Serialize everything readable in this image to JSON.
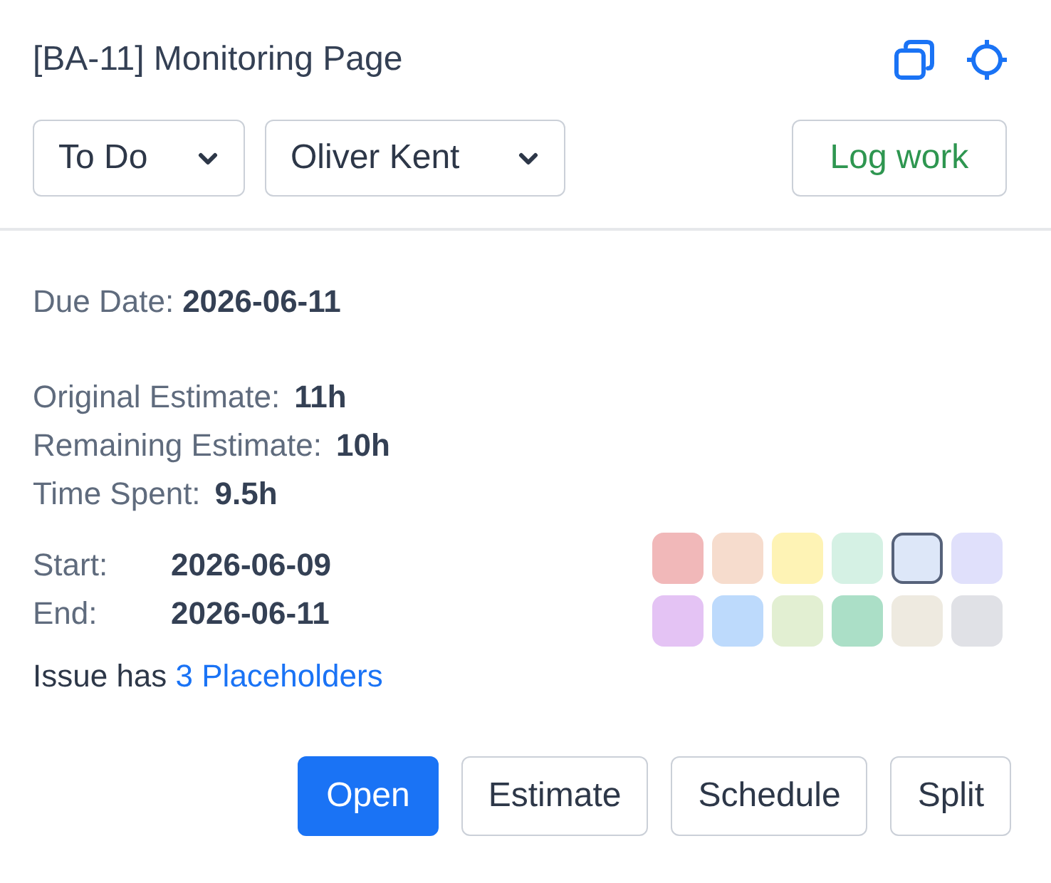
{
  "header": {
    "title": "[BA-11] Monitoring Page"
  },
  "dropdowns": [
    {
      "value": "To Do"
    },
    {
      "value": "Oliver Kent"
    }
  ],
  "log_work_button": {
    "label": "Log work"
  },
  "due_date": {
    "label": "Due Date:",
    "value": "2026-06-11"
  },
  "estimates": [
    {
      "label": "Original Estimate:",
      "value": "11h"
    },
    {
      "label": "Remaining Estimate:",
      "value": "10h"
    },
    {
      "label": "Time Spent:",
      "value": "9.5h"
    }
  ],
  "schedule": [
    {
      "label": "Start:",
      "value": "2026-06-09"
    },
    {
      "label": "End:",
      "value": "2026-06-11"
    }
  ],
  "placeholder_note": {
    "text": "Issue has",
    "link": "3 Placeholders"
  },
  "swatches": [
    {
      "color": "#f1b8b9",
      "selected": false
    },
    {
      "color": "#f6dccd",
      "selected": false
    },
    {
      "color": "#fef3b5",
      "selected": false
    },
    {
      "color": "#d5f1e4",
      "selected": false
    },
    {
      "color": "#dde7f8",
      "selected": true
    },
    {
      "color": "#e0e0fb",
      "selected": false
    },
    {
      "color": "#e4c3f4",
      "selected": false
    },
    {
      "color": "#bddafc",
      "selected": false
    },
    {
      "color": "#e2efd2",
      "selected": false
    },
    {
      "color": "#abdfc7",
      "selected": false
    },
    {
      "color": "#eeeae0",
      "selected": false
    },
    {
      "color": "#e0e1e6",
      "selected": false
    }
  ],
  "actions": [
    {
      "label": "Open",
      "kind": "primary"
    },
    {
      "label": "Estimate",
      "kind": "secondary"
    },
    {
      "label": "Schedule",
      "kind": "secondary"
    },
    {
      "label": "Split",
      "kind": "secondary"
    }
  ]
}
